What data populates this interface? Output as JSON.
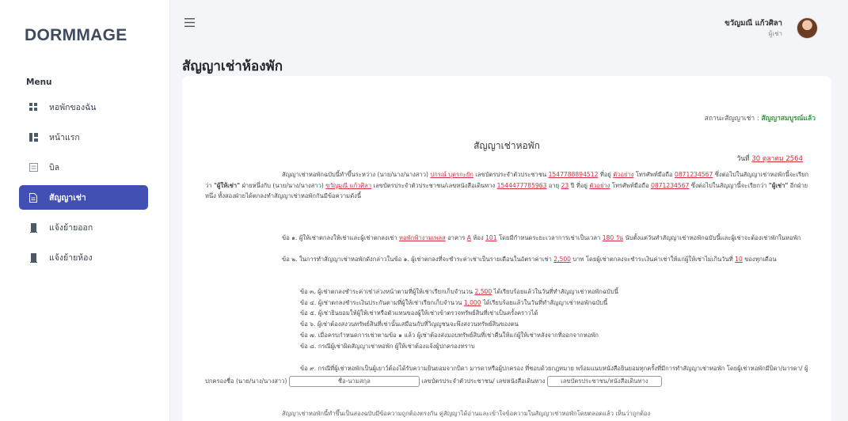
{
  "app": {
    "logo": "DORMMAGE"
  },
  "sidebar": {
    "menu_title": "Menu",
    "items": [
      {
        "label": "หอพักของฉัน",
        "icon": "grid-icon",
        "active": false
      },
      {
        "label": "หน้าแรก",
        "icon": "dashboard-icon",
        "active": false
      },
      {
        "label": "บิล",
        "icon": "bill-icon",
        "active": false
      },
      {
        "label": "สัญญาเช่า",
        "icon": "document-icon",
        "active": true
      },
      {
        "label": "แจ้งย้ายออก",
        "icon": "building-icon",
        "active": false
      },
      {
        "label": "แจ้งย้ายห้อง",
        "icon": "building-icon",
        "active": false
      }
    ]
  },
  "header": {
    "user_name": "ขวัญมณี แก้วศิลา",
    "user_role": "ผู้เช่า"
  },
  "page": {
    "title": "สัญญาเช่าห้องพัก"
  },
  "contract": {
    "status_label": "สถานะสัญญาเช่า : ",
    "status_value": "สัญญาสมบูรณ์แล้ว",
    "doc_title": "สัญญาเช่าหอพัก",
    "date_prefix": "วันที่ ",
    "date_value": "30 ตุลาคม 2564",
    "p1": {
      "t1": "สัญญาเช่าหอพักฉบับนี้ทำขึ้นระหว่าง (นาย/นาง/นางสาว) ",
      "landlord_name": "ปกรณ์ บุตรกะยัก",
      "t2": " เลขบัตรประจำตัวประชาชน ",
      "landlord_id": "1547788894512",
      "t3": " ที่อยู่ ",
      "landlord_addr": "ตัวอย่าง",
      "t4": " โทรศัพท์มือถือ ",
      "landlord_phone": "0871234567",
      "t5": " ซึ่งต่อไปในสัญญาเช่าหอพักนี้จะเรียกว่า ",
      "landlord_term": "\"ผู้ให้เช่า\"",
      "t6": " ฝ่ายหนึ่งกับ (นาย/นาง/นางสาว) ",
      "tenant_name": "ขวัญมณี แก้วศิลา",
      "t7": " เลขบัตรประจำตัวประชาชน/เลขหนังสือเดินทาง ",
      "tenant_id": "1544477785963",
      "t8": " อายุ ",
      "tenant_age": "23",
      "t9": " ปี ที่อยู่ ",
      "tenant_addr": "ตัวอย่าง",
      "t10": " โทรศัพท์มือถือ ",
      "tenant_phone": "0871234567",
      "t11": " ซึ่งต่อไปในสัญญานี้จะเรียกว่า ",
      "tenant_term": "\"ผู้เช่า\"",
      "t12": " อีกฝ่ายหนึ่ง ทั้งสองฝ่ายได้ตกลงทำสัญญาเช่าหอพักกันมีข้อความดังนี้"
    },
    "p2": {
      "t1": "ข้อ ๑. ผู้ให้เช่าตกลงให้เช่าและผู้เช่าตกลงเช่า ",
      "dorm": "หอพักฟ้างามเพลส",
      "t2": " อาคาร ",
      "building": "A",
      "t3": " ห้อง ",
      "room": "101",
      "t4": " โดยมีกำหนดระยะเวลาการเช่าเป็นเวลา ",
      "duration": "180 วัน",
      "t5": " นับตั้งแต่วันทำสัญญาเช่าหอพักฉบับนี้และผู้เช่าจะต้องเช่าพักในหอพัก"
    },
    "p3": {
      "t1": "ข้อ ๒. ในการทำสัญญาเช่าหอพักดังกล่าวในข้อ ๑. ผู้เช่าตกลงที่จะชำระค่าเช่าเป็นรายเดือนในอัตราค่าเช่า ",
      "rent": "2,500",
      "t2": " บาท โดยผู้เช่าตกลงจะชำระเงินค่าเช่าให้แก่ผู้ให้เช่าไม่เกินวันที่ ",
      "due_day": "10",
      "t3": " ของทุกเดือน"
    },
    "c3": {
      "t1": "ข้อ ๓. ผู้เช่าตกลงชำระค่าเช่าล่วงหน้าตามที่ผู้ให้เช่าเรียกเก็บจำนวน ",
      "advance": "2,500",
      "t2": " ได้เรียบร้อยแล้วในวันที่ทำสัญญาเช่าหอพักฉบับนี้"
    },
    "c4": {
      "t1": "ข้อ ๔. ผู้เช่าตกลงชำระเงินประกันตามที่ผู้ให้เช่าเรียกเก็บจำนวน ",
      "deposit": "1,000",
      "t2": " ได้เรียบร้อยแล้วในวันที่ทำสัญญาเช่าหอพักฉบับนี้"
    },
    "c5": "ข้อ ๕. ผู้เช่ายินยอมให้ผู้ให้เช่าหรือตัวแทนของผู้ให้เช่าเข้าตรวจทรัพย์สินที่เช่าเป็นครั้งคราวได้",
    "c6": "ข้อ ๖. ผู้เช่าต้องสงวนทรัพย์สินที่เช่านั้นเสมือนกับที่วิญญูชนจะพึงสงวนทรัพย์สินของตน",
    "c7": "ข้อ ๗. เมื่อครบกำหนดการเช่าตามข้อ ๑ แล้ว ผู้เช่าต้องส่งมอบทรัพย์สินที่เช่าคืนให้แก่ผู้ให้เช่าหลังจากที่ออกจากหอพัก",
    "c8": "ข้อ ๘. กรณีผู้เช่าผิดสัญญาเช่าหอพัก ผู้ให้เช่าต้องแจ้งผู้ปกครองทราบ",
    "c9": {
      "t1": "ข้อ ๙. กรณีที่ผู้เช่าหอพักเป็นผู้เยาว์ต้องได้รับความยินยอมจากบิดา มารดาหรือผู้ปกครอง ที่ชอบด้วยกฎหมาย พร้อมแนบหนังสือยินยอมทุกครั้งที่มีการทำสัญญาเช่าหอพัก โดยผู้เช่าหอพักมีบิดา/มารดา/ ผู้ปกครองชื่อ (นาย/นาง/นางสาว) ",
      "name_placeholder": "ชื่อ-นามสกุล",
      "t2": " เลขบัตรประจำตัวประชาชน/ เลขหนังสือเดินทาง ",
      "id_placeholder": "เลขบัตรประชาชน/หนังสือเดินทาง"
    },
    "p_last": "สัญญาเช่าหอพักนี้ทำขึ้นเป็นสองฉบับมีข้อความถูกต้องตรงกัน คู่สัญญาได้อ่านและเข้าใจข้อความในสัญญาเช่าหอพักโดยตลอดแล้ว เห็นว่าถูกต้อง"
  }
}
